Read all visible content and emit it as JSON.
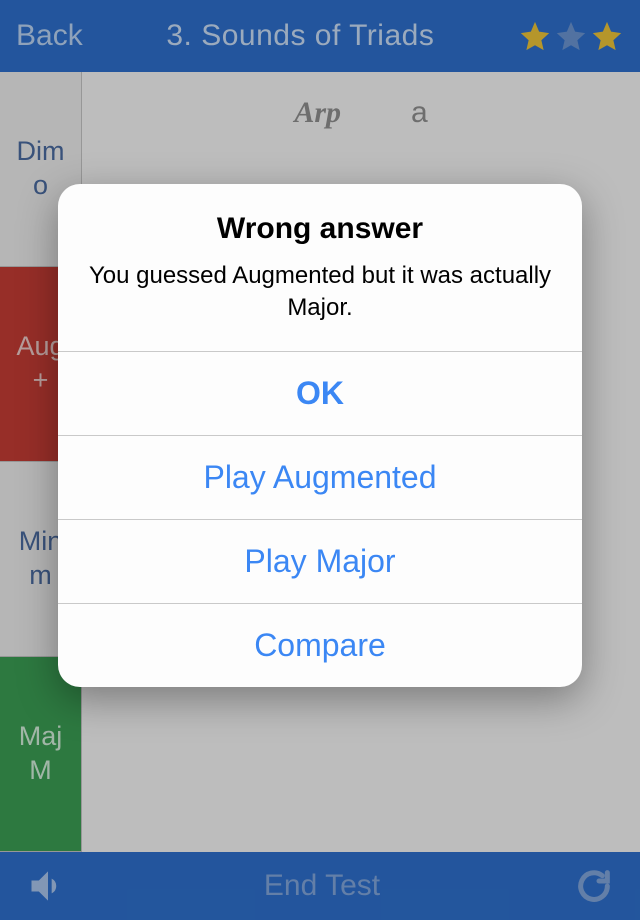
{
  "header": {
    "back_label": "Back",
    "title": "3. Sounds of Triads",
    "stars": {
      "filled": [
        true,
        false,
        true
      ]
    }
  },
  "sidebar": {
    "items": [
      {
        "line1": "Dim",
        "line2": "o",
        "kind": "dim"
      },
      {
        "line1": "Aug",
        "line2": "+",
        "kind": "aug"
      },
      {
        "line1": "Min",
        "line2": "m",
        "kind": "min"
      },
      {
        "line1": "Maj",
        "line2": "M",
        "kind": "maj"
      }
    ]
  },
  "stage": {
    "arp_label": "Arp",
    "a_label": "a"
  },
  "footer": {
    "end_label": "End Test"
  },
  "modal": {
    "title": "Wrong answer",
    "message": "You guessed Augmented but it was actually Major.",
    "buttons": {
      "ok": "OK",
      "play_guess": "Play Augmented",
      "play_actual": "Play Major",
      "compare": "Compare"
    }
  }
}
